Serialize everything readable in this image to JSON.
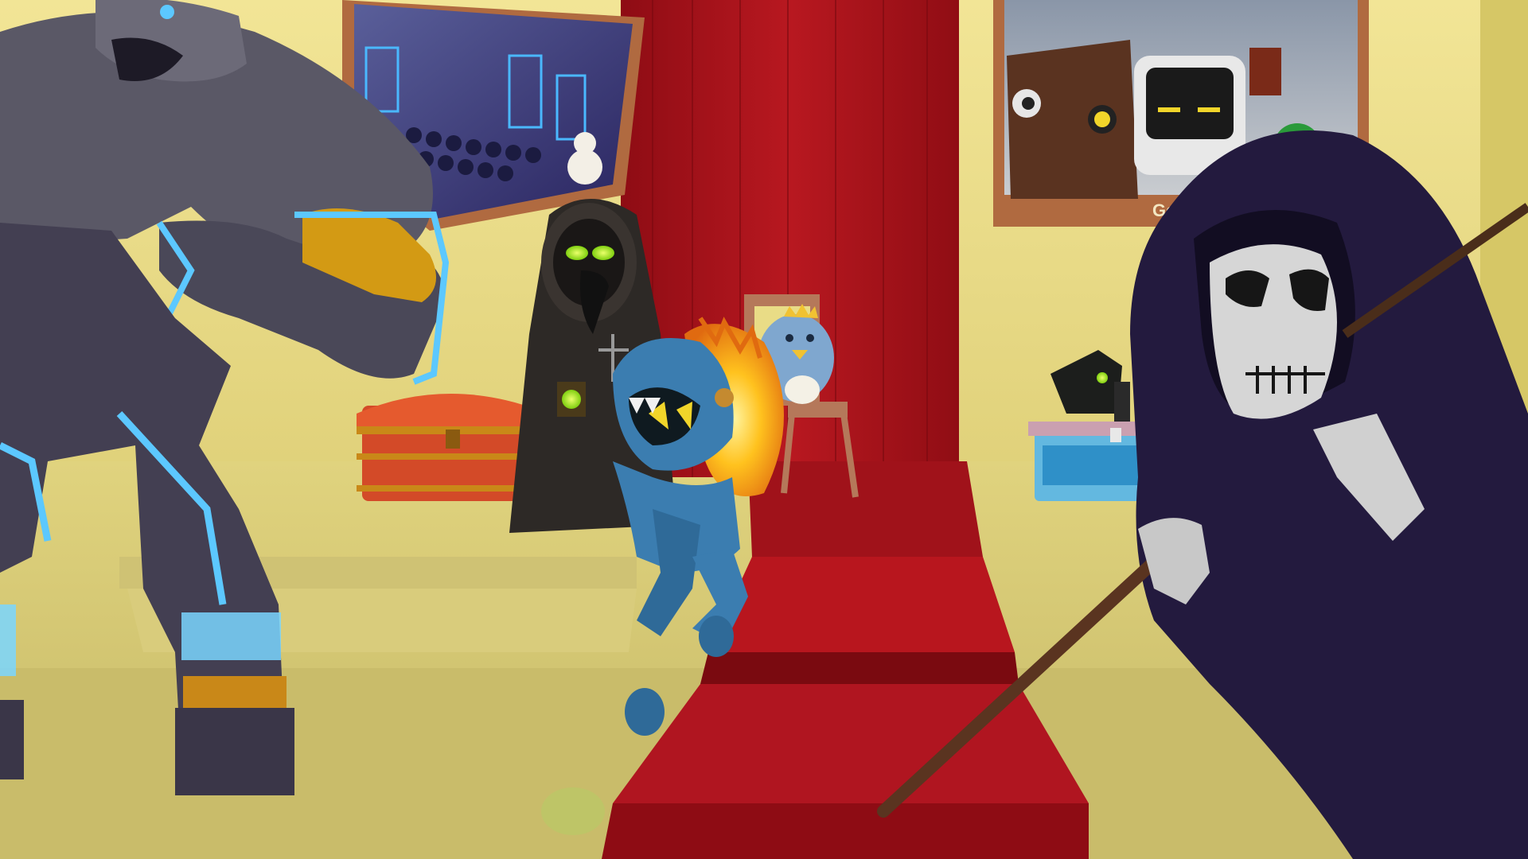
{
  "scene": {
    "description_hidden": "",
    "colors": {
      "wall": "#e9dc86",
      "wall_shadow": "#cdbf5e",
      "floor": "#d6c978",
      "carpet": "#b3121a",
      "carpet_dark": "#7a0a10",
      "golem_body": "#4c4a5a",
      "golem_glow": "#5cc8ff",
      "golem_gold": "#d39a14",
      "reaper_robe": "#231a3e",
      "skull": "#d8d8d8",
      "blue_creature": "#3d7fb0",
      "fire": "#ffb21f",
      "chest_red": "#d84a2a",
      "chest_blue": "#4aa8d8",
      "plague_robe": "#2a2624",
      "eye_green": "#b6ff2a"
    }
  },
  "painting_right": {
    "caption": "Gen I"
  },
  "icons": {
    "golem": "stone-golem-icon",
    "reaper": "grim-reaper-icon",
    "plague_doctor": "plague-doctor-icon",
    "creature": "blue-fire-creature-icon",
    "penguin": "penguin-king-icon"
  }
}
